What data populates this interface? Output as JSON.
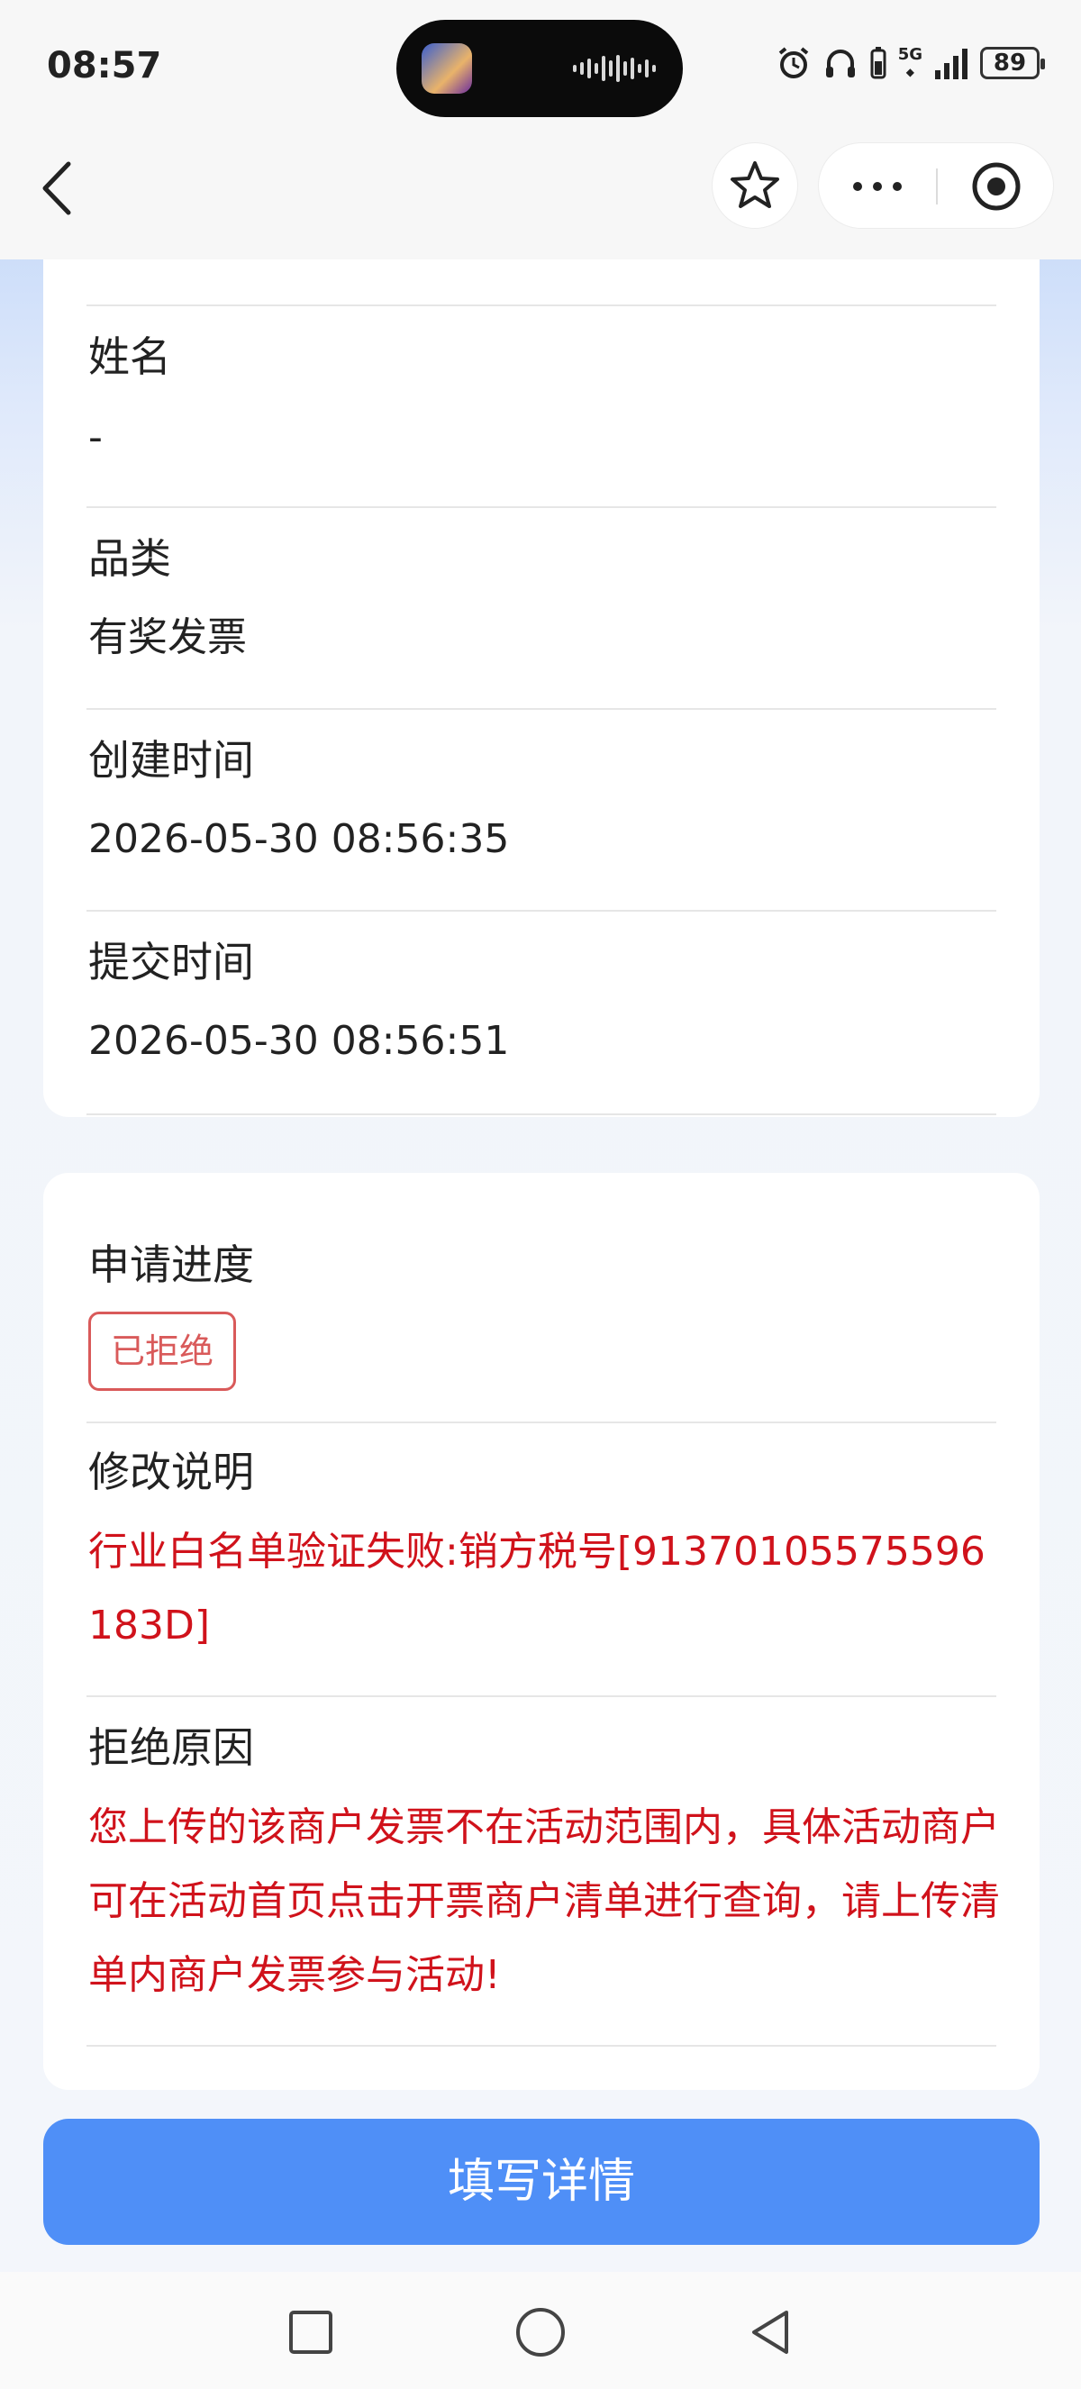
{
  "status_bar": {
    "time": "08:57",
    "network": "5G",
    "battery": "89"
  },
  "info_card": {
    "fields": [
      {
        "label": "姓名",
        "value": "-"
      },
      {
        "label": "品类",
        "value": "有奖发票"
      },
      {
        "label": "创建时间",
        "value": "2026-05-30 08:56:35"
      },
      {
        "label": "提交时间",
        "value": "2026-05-30 08:56:51"
      }
    ]
  },
  "progress_card": {
    "progress_label": "申请进度",
    "progress_status": "已拒绝",
    "modify_label": "修改说明",
    "modify_value": "行业白名单验证失败:销方税号[91370105575596183D]",
    "reject_label": "拒绝原因",
    "reject_value": "您上传的该商户发票不在活动范围内，具体活动商户可在活动首页点击开票商户清单进行查询，请上传清单内商户发票参与活动!"
  },
  "action_button": {
    "label": "填写详情"
  },
  "colors": {
    "accent": "#4f8ff7",
    "error_text": "#d0121b",
    "rejected_tag": "#d95a5a"
  },
  "icons": {
    "back": "chevron-left-icon",
    "favorite": "star-outline-icon",
    "more": "more-dots-icon",
    "close": "target-circle-icon",
    "recent_apps": "square-icon",
    "home": "circle-icon",
    "system_back": "triangle-back-icon"
  }
}
